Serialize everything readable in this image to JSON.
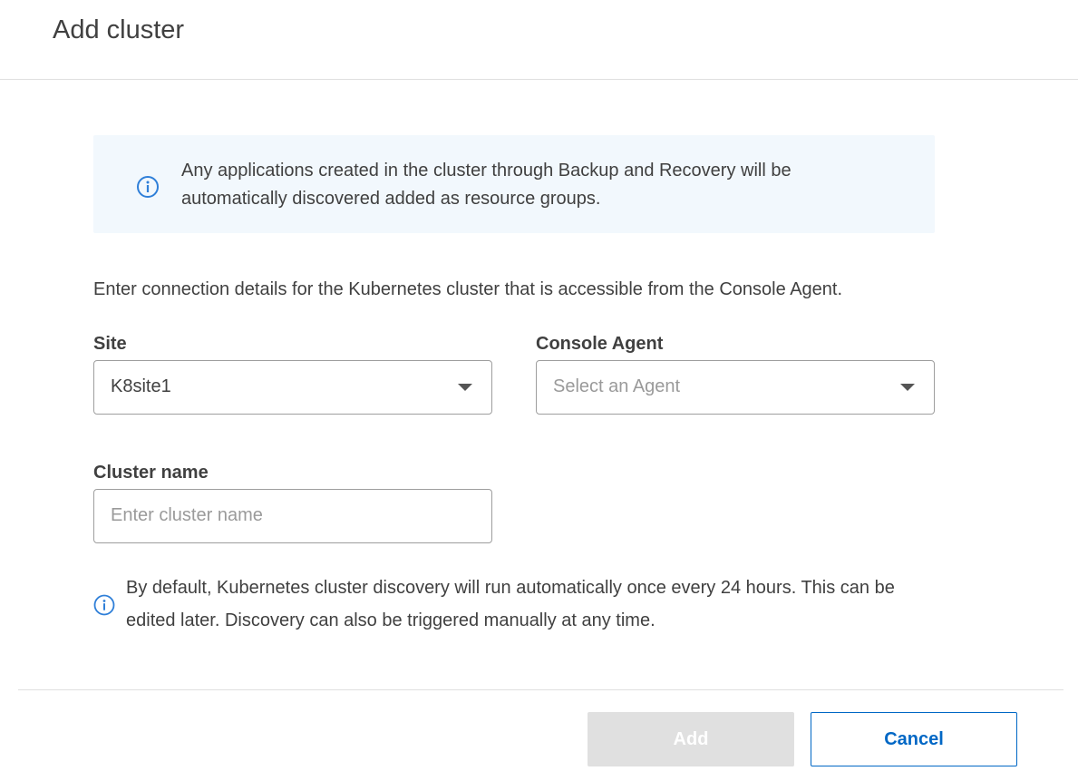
{
  "dialog": {
    "title": "Add cluster"
  },
  "banner": {
    "icon": "info-icon",
    "text": "Any applications created in the cluster through Backup and Recovery will be automatically discovered added as resource groups."
  },
  "intro_text": "Enter connection details for the Kubernetes cluster that is accessible from the Console Agent.",
  "fields": {
    "site": {
      "label": "Site",
      "value": "K8site1"
    },
    "console_agent": {
      "label": "Console Agent",
      "placeholder": "Select an Agent",
      "value": ""
    },
    "cluster_name": {
      "label": "Cluster name",
      "placeholder": "Enter cluster name",
      "value": ""
    }
  },
  "note": {
    "icon": "info-icon",
    "text": "By default, Kubernetes cluster discovery will run automatically once every 24 hours. This can be edited later. Discovery can also be triggered manually at any time."
  },
  "buttons": {
    "add_label": "Add",
    "cancel_label": "Cancel"
  },
  "colors": {
    "accent": "#0067c5",
    "banner_bg": "#f2f8fd",
    "info_icon": "#2f7fd8",
    "disabled_bg": "#e0e0e0"
  }
}
